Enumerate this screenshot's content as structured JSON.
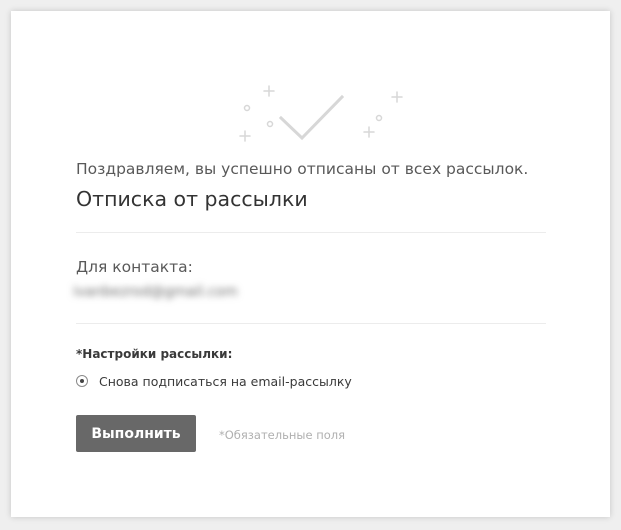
{
  "message": {
    "success_text": "Поздравляем, вы успешно отписаны от всех рассылок.",
    "title": "Отписка от рассылки"
  },
  "contact": {
    "label": "Для контакта:",
    "email": "ivanbezrod@gmail.com"
  },
  "settings": {
    "label": "*Настройки рассылки:",
    "option_label": "Снова подписаться на email-рассылку",
    "option_selected": true
  },
  "form": {
    "submit_label": "Выполнить",
    "required_note": "*Обязательные поля"
  },
  "colors": {
    "button": "#686868",
    "icon": "#d7d7d7"
  },
  "icons": {
    "hero": "checkmark-sparkle-icon"
  }
}
